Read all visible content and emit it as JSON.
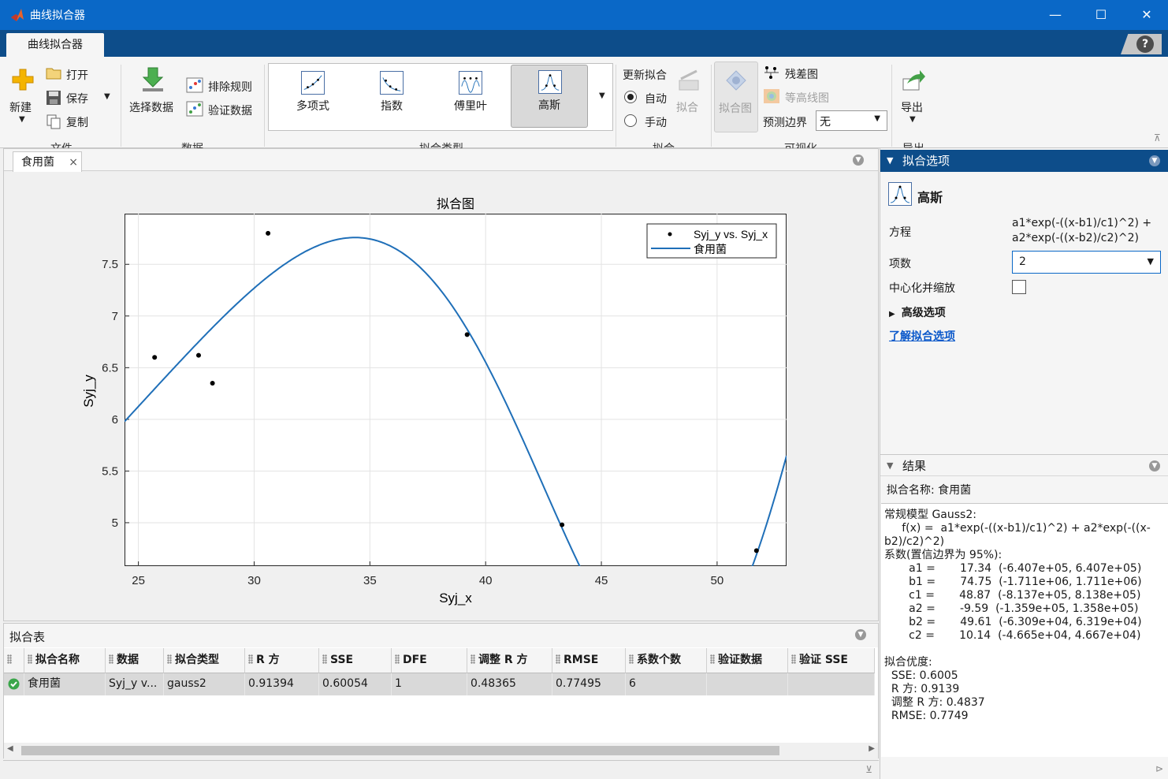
{
  "window": {
    "title": "曲线拟合器",
    "minimize": "—",
    "maximize": "☐",
    "close": "✕"
  },
  "tabs": {
    "main": "曲线拟合器",
    "help": "?"
  },
  "ribbon": {
    "file": {
      "section": "文件",
      "new": "新建",
      "open": "打开",
      "save": "保存",
      "copy": "复制"
    },
    "data": {
      "section": "数据",
      "select": "选择数据",
      "exclude": "排除规则",
      "validate": "验证数据"
    },
    "fittype": {
      "section": "拟合类型",
      "items": [
        "多项式",
        "指数",
        "傅里叶",
        "高斯"
      ],
      "selected": "高斯"
    },
    "fit": {
      "section": "拟合",
      "update": "更新拟合",
      "auto": "自动",
      "manual": "手动",
      "fit": "拟合",
      "auto_selected": true
    },
    "visual": {
      "section": "可视化",
      "fitplot": "拟合图",
      "residual": "残差图",
      "contour": "等高线图",
      "bounds_label": "预测边界",
      "bounds_value": "无"
    },
    "export": {
      "section": "导出",
      "export": "导出"
    }
  },
  "doc": {
    "tab": "食用菌"
  },
  "chart_data": {
    "type": "scatter",
    "title": "拟合图",
    "xlabel": "Syj_x",
    "ylabel": "Syj_y",
    "xlim": [
      24.4,
      53
    ],
    "ylim": [
      4.58,
      7.99
    ],
    "xticks": [
      25,
      30,
      35,
      40,
      45,
      50
    ],
    "yticks": [
      5,
      5.5,
      6,
      6.5,
      7,
      7.5
    ],
    "xticklabels": [
      "25",
      "30",
      "35",
      "40",
      "45",
      "50"
    ],
    "yticklabels": [
      "5",
      "5.5",
      "6",
      "6.5",
      "7",
      "7.5"
    ],
    "grid": true,
    "legend_position": "top-right",
    "series": [
      {
        "name": "Syj_y vs. Syj_x",
        "kind": "points",
        "color": "#000000",
        "x": [
          25.7,
          27.6,
          28.2,
          30.6,
          39.2,
          43.3,
          51.7
        ],
        "y": [
          6.6,
          6.62,
          6.35,
          7.8,
          6.82,
          4.98,
          4.73
        ]
      },
      {
        "name": "食用菌",
        "kind": "fit",
        "color": "#1f6fb8",
        "model": "gauss2",
        "coefficients": {
          "a1": 17.34,
          "b1": 74.75,
          "c1": 48.87,
          "a2": -9.59,
          "b2": 49.61,
          "c2": 10.14
        }
      }
    ]
  },
  "options": {
    "header": "拟合选项",
    "model_name": "高斯",
    "equation_label": "方程",
    "equation_line1": "a1*exp(-((x-b1)/c1)^2) +",
    "equation_line2": "a2*exp(-((x-b2)/c2)^2)",
    "terms_label": "项数",
    "terms_value": "2",
    "center_label": "中心化并缩放",
    "advanced": "高级选项",
    "learn": "了解拟合选项"
  },
  "results": {
    "header": "结果",
    "fitname": "拟合名称: 食用菌",
    "text": "常规模型 Gauss2:\n     f(x) =  a1*exp(-((x-b1)/c1)^2) + a2*exp(-((x-\nb2)/c2)^2)\n系数(置信边界为 95%):\n       a1 =       17.34  (-6.407e+05, 6.407e+05)\n       b1 =       74.75  (-1.711e+06, 1.711e+06)\n       c1 =       48.87  (-8.137e+05, 8.138e+05)\n       a2 =       -9.59  (-1.359e+05, 1.358e+05)\n       b2 =       49.61  (-6.309e+04, 6.319e+04)\n       c2 =       10.14  (-4.665e+04, 4.667e+04)\n\n拟合优度:\n  SSE: 0.6005\n  R 方: 0.9139\n  调整 R 方: 0.4837\n  RMSE: 0.7749"
  },
  "table": {
    "title": "拟合表",
    "columns": [
      "拟合名称",
      "数据",
      "拟合类型",
      "R 方",
      "SSE",
      "DFE",
      "调整 R 方",
      "RMSE",
      "系数个数",
      "验证数据",
      "验证 SSE"
    ],
    "row": [
      "食用菌",
      "Syj_y v...",
      "gauss2",
      "0.91394",
      "0.60054",
      "1",
      "0.48365",
      "0.77495",
      "6",
      "",
      ""
    ]
  }
}
